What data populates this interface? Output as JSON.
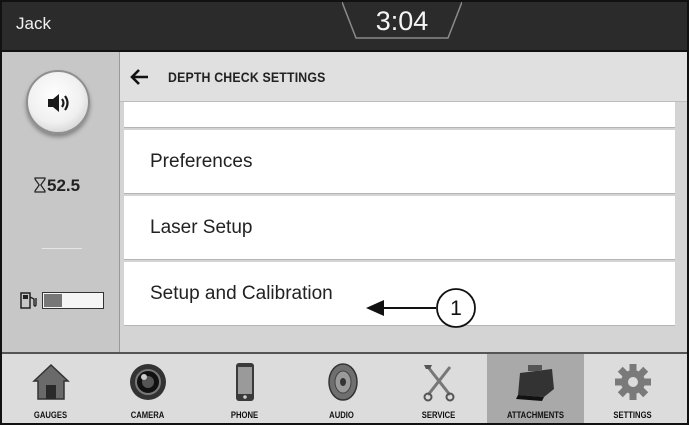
{
  "status_bar": {
    "user": "Jack",
    "clock": "3:04"
  },
  "left_panel": {
    "hours_value": "52.5",
    "fuel_level": 0.3
  },
  "header": {
    "title": "DEPTH CHECK SETTINGS"
  },
  "menu": {
    "items": [
      {
        "label": "Preferences"
      },
      {
        "label": "Laser Setup"
      },
      {
        "label": "Setup and Calibration"
      }
    ]
  },
  "callout": {
    "number": "1"
  },
  "tabs": [
    {
      "label": "GAUGES",
      "icon": "house-icon"
    },
    {
      "label": "CAMERA",
      "icon": "camera-icon"
    },
    {
      "label": "PHONE",
      "icon": "phone-icon"
    },
    {
      "label": "AUDIO",
      "icon": "speaker-icon"
    },
    {
      "label": "SERVICE",
      "icon": "wrench-icon"
    },
    {
      "label": "ATTACHMENTS",
      "icon": "bucket-icon",
      "active": true
    },
    {
      "label": "SETTINGS",
      "icon": "gear-icon"
    }
  ]
}
